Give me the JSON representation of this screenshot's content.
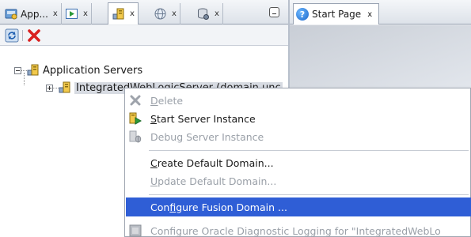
{
  "left_tabs": [
    {
      "label": "App...",
      "close": "x"
    },
    {
      "label": "",
      "close": "x"
    },
    {
      "label": "",
      "close": "x"
    },
    {
      "label": "",
      "close": "x"
    },
    {
      "label": "",
      "close": "x"
    }
  ],
  "right_tab": {
    "label": "Start Page",
    "close": "x",
    "icon": "?"
  },
  "tree": {
    "root": "Application Servers",
    "child": "IntegratedWebLogicServer (domain unc"
  },
  "menu": {
    "delete": {
      "pre": "",
      "key": "D",
      "post": "elete"
    },
    "start": {
      "pre": "",
      "key": "S",
      "post": "tart Server Instance"
    },
    "debug": {
      "pre": "Debu",
      "key": "g",
      "post": " Server Instance"
    },
    "create": {
      "pre": "",
      "key": "C",
      "post": "reate Default Domain..."
    },
    "update": {
      "pre": "",
      "key": "U",
      "post": "pdate Default Domain..."
    },
    "configure_fusion": {
      "pre": "Con",
      "key": "f",
      "post": "igure Fusion Domain ..."
    },
    "configure_odl": {
      "label": "Configure Oracle Diagnostic Logging for \"IntegratedWebLo"
    }
  },
  "colors": {
    "highlight": "#2f5ed6",
    "delete_red": "#d92020"
  }
}
